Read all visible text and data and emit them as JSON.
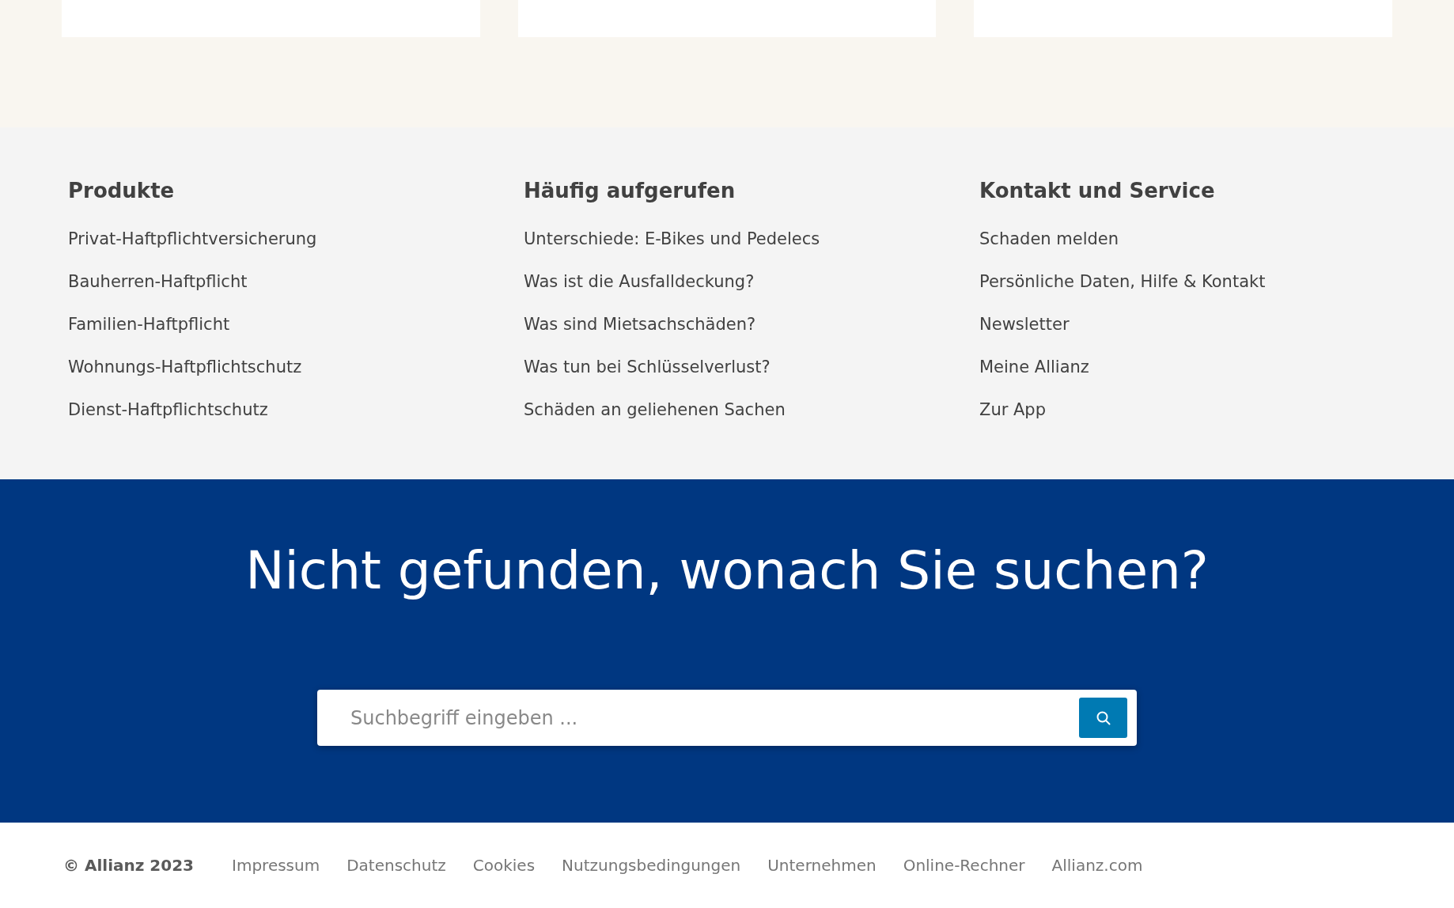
{
  "columns": [
    {
      "heading": "Produkte",
      "links": [
        "Privat-Haftpflichtversicherung",
        "Bauherren-Haftpflicht",
        "Familien-Haftpflicht",
        "Wohnungs-Haftpflichtschutz",
        "Dienst-Haftpflichtschutz"
      ]
    },
    {
      "heading": "Häufig aufgerufen",
      "links": [
        "Unterschiede: E-Bikes und Pedelecs",
        "Was ist die Ausfalldeckung?",
        "Was sind Mietsachschäden?",
        "Was tun bei Schlüsselverlust?",
        "Schäden an geliehenen Sachen"
      ]
    },
    {
      "heading": "Kontakt und Service",
      "links": [
        "Schaden melden",
        "Persönliche Daten, Hilfe & Kontakt",
        "Newsletter",
        "Meine Allianz",
        "Zur App"
      ]
    }
  ],
  "search_section": {
    "heading": "Nicht gefunden, wonach Sie suchen?",
    "search": {
      "placeholder": "Suchbegriff eingeben ..."
    }
  },
  "footer": {
    "copyright": "© Allianz 2023",
    "links": [
      "Impressum",
      "Datenschutz",
      "Cookies",
      "Nutzungsbedingungen",
      "Unternehmen",
      "Online-Rechner",
      "Allianz.com"
    ]
  }
}
